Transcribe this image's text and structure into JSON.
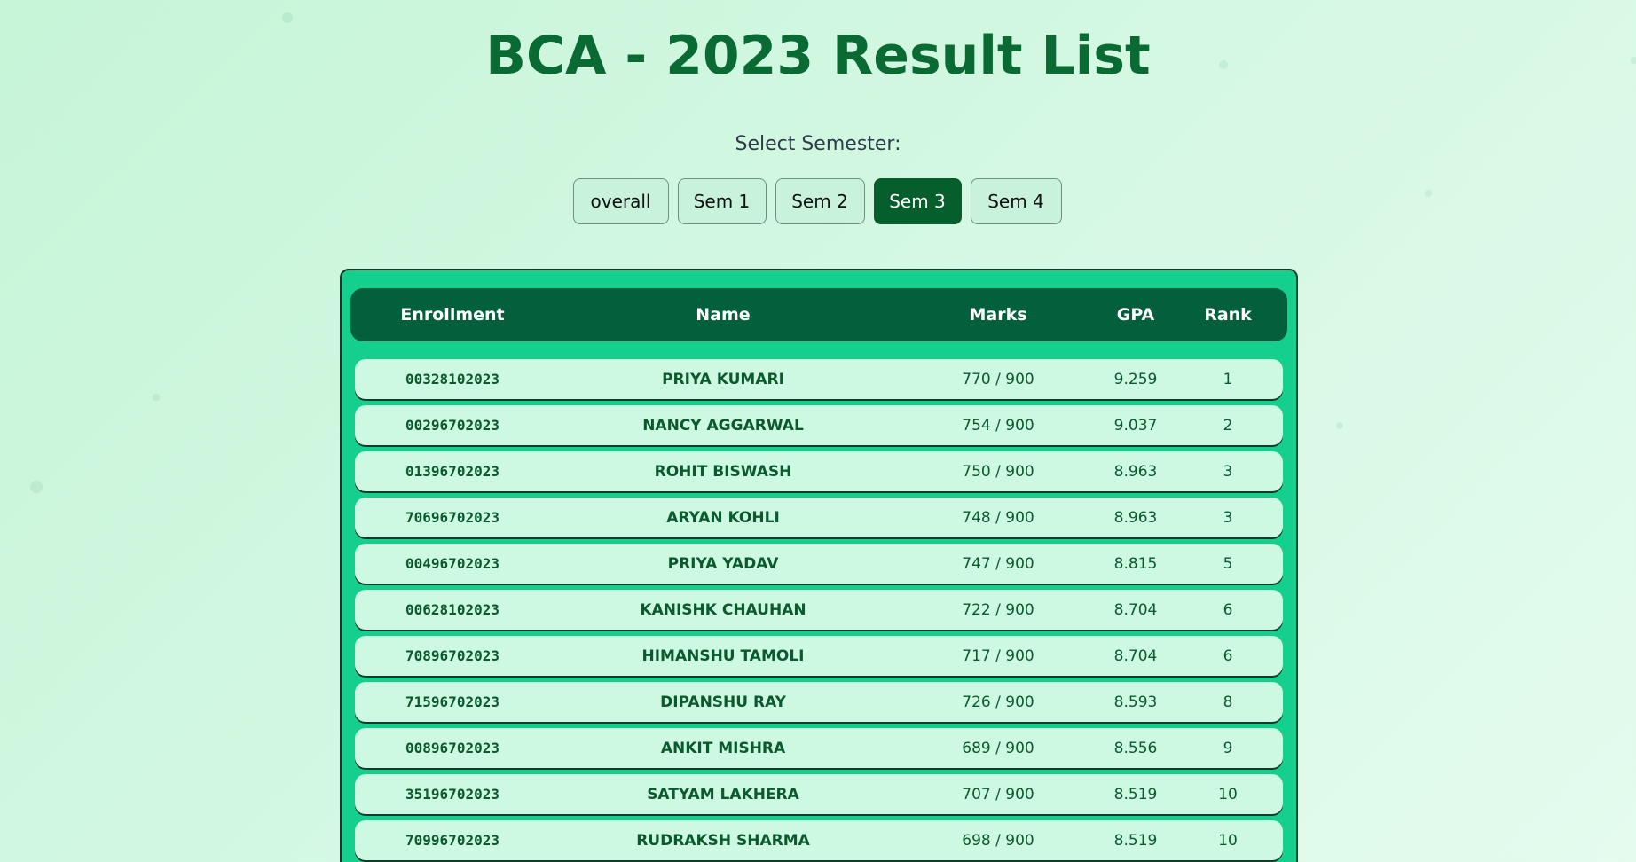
{
  "page": {
    "title": "BCA - 2023 Result List",
    "select_label": "Select Semester:"
  },
  "semesters": [
    {
      "label": "overall",
      "active": false
    },
    {
      "label": "Sem 1",
      "active": false
    },
    {
      "label": "Sem 2",
      "active": false
    },
    {
      "label": "Sem 3",
      "active": true
    },
    {
      "label": "Sem 4",
      "active": false
    }
  ],
  "table": {
    "headers": {
      "enrollment": "Enrollment",
      "name": "Name",
      "marks": "Marks",
      "gpa": "GPA",
      "rank": "Rank"
    },
    "rows": [
      {
        "enrollment": "00328102023",
        "name": "PRIYA KUMARI",
        "marks": "770 / 900",
        "gpa": "9.259",
        "rank": "1"
      },
      {
        "enrollment": "00296702023",
        "name": "NANCY AGGARWAL",
        "marks": "754 / 900",
        "gpa": "9.037",
        "rank": "2"
      },
      {
        "enrollment": "01396702023",
        "name": "ROHIT BISWASH",
        "marks": "750 / 900",
        "gpa": "8.963",
        "rank": "3"
      },
      {
        "enrollment": "70696702023",
        "name": "ARYAN KOHLI",
        "marks": "748 / 900",
        "gpa": "8.963",
        "rank": "3"
      },
      {
        "enrollment": "00496702023",
        "name": "PRIYA YADAV",
        "marks": "747 / 900",
        "gpa": "8.815",
        "rank": "5"
      },
      {
        "enrollment": "00628102023",
        "name": "KANISHK CHAUHAN",
        "marks": "722 / 900",
        "gpa": "8.704",
        "rank": "6"
      },
      {
        "enrollment": "70896702023",
        "name": "HIMANSHU TAMOLI",
        "marks": "717 / 900",
        "gpa": "8.704",
        "rank": "6"
      },
      {
        "enrollment": "71596702023",
        "name": "DIPANSHU RAY",
        "marks": "726 / 900",
        "gpa": "8.593",
        "rank": "8"
      },
      {
        "enrollment": "00896702023",
        "name": "ANKIT MISHRA",
        "marks": "689 / 900",
        "gpa": "8.556",
        "rank": "9"
      },
      {
        "enrollment": "35196702023",
        "name": "SATYAM LAKHERA",
        "marks": "707 / 900",
        "gpa": "8.519",
        "rank": "10"
      },
      {
        "enrollment": "70996702023",
        "name": "RUDRAKSH SHARMA",
        "marks": "698 / 900",
        "gpa": "8.519",
        "rank": "10"
      }
    ]
  },
  "colors": {
    "title": "#0a6a34",
    "active_button": "#075e2d",
    "table_frame": "#14cf8d",
    "table_header": "#035f3c",
    "row_bg": "#cdf8e2"
  }
}
